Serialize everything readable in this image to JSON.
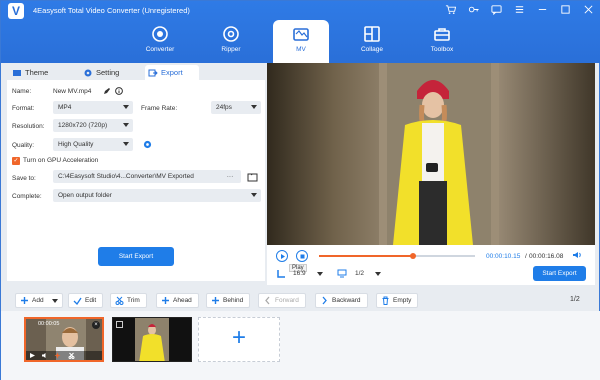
{
  "app": {
    "title": "4Easysoft Total Video Converter (Unregistered)"
  },
  "nav": [
    {
      "label": "Converter"
    },
    {
      "label": "Ripper"
    },
    {
      "label": "MV"
    },
    {
      "label": "Collage"
    },
    {
      "label": "Toolbox"
    }
  ],
  "subtabs": {
    "theme": "Theme",
    "setting": "Setting",
    "export": "Export"
  },
  "form": {
    "name_label": "Name:",
    "name_value": "New MV.mp4",
    "format_label": "Format:",
    "format_value": "MP4",
    "framerate_label": "Frame Rate:",
    "framerate_value": "24fps",
    "resolution_label": "Resolution:",
    "resolution_value": "1280x720 (720p)",
    "quality_label": "Quality:",
    "quality_value": "High Quality",
    "gpu_label": "Turn on GPU Acceleration",
    "saveto_label": "Save to:",
    "saveto_value": "C:\\4Easysoft Studio\\4...Converter\\MV Exported",
    "saveto_more": "···",
    "complete_label": "Complete:",
    "complete_value": "Open output folder",
    "start_export": "Start Export"
  },
  "player": {
    "play_tooltip": "Play",
    "time_current": "00:00:10.15",
    "time_total": "00:00:16.08",
    "time_sep": "/",
    "progress": 0.6,
    "aspect": "16:9",
    "page": "1/2",
    "start_export": "Start Export"
  },
  "toolbar": {
    "add": "Add",
    "edit": "Edit",
    "trim": "Trim",
    "ahead": "Ahead",
    "behind": "Behind",
    "forward": "Forward",
    "backward": "Backward",
    "empty": "Empty",
    "page_current": "1",
    "page_total": "2",
    "page_sep": "/"
  },
  "clips": {
    "clip1_time": "00:00:05",
    "add_symbol": "+"
  },
  "colors": {
    "brand": "#2a6fd8",
    "accent": "#f0662a",
    "button": "#1f7de8"
  }
}
